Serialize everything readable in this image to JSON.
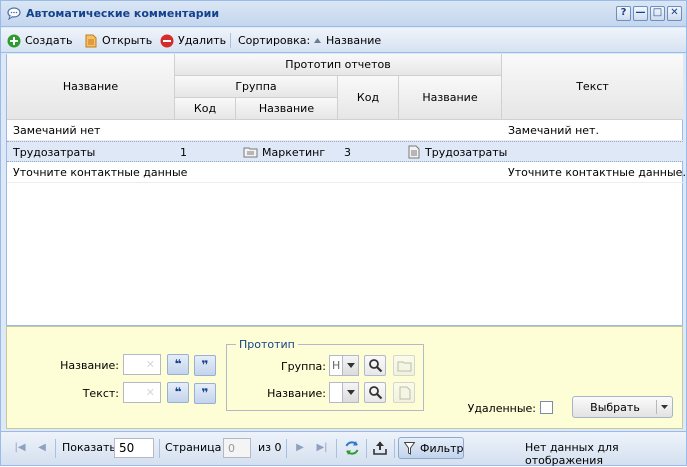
{
  "window": {
    "title": "Автоматические комментарии",
    "buttons": [
      "?",
      "—",
      "□",
      "✕"
    ]
  },
  "toolbar": {
    "create_label": "Создать",
    "open_label": "Открыть",
    "delete_label": "Удалить",
    "sort_label": "Сортировка:",
    "sort_field": "Название"
  },
  "grid": {
    "headers": {
      "name": "Название",
      "prototype": "Прототип отчетов",
      "group": "Группа",
      "group_code": "Код",
      "group_name": "Название",
      "proto_code": "Код",
      "proto_name": "Название",
      "text": "Текст"
    },
    "rows": [
      {
        "name": "Замечаний нет",
        "group_code": "",
        "group_name": "",
        "proto_code": "",
        "proto_name": "",
        "text": "Замечаний нет."
      },
      {
        "name": "Трудозатраты",
        "group_code": "1",
        "group_name": "Маркетинг",
        "proto_code": "3",
        "proto_name": "Трудозатраты",
        "text": ""
      },
      {
        "name": "Уточните контактные данные",
        "group_code": "",
        "group_name": "",
        "proto_code": "",
        "proto_name": "",
        "text": "Уточните контактные данные."
      }
    ]
  },
  "filter": {
    "name_label": "Название:",
    "text_label": "Текст:",
    "prototype_legend": "Прототип",
    "group_label": "Группа:",
    "group_value": "Н",
    "proto_name_label": "Название:",
    "deleted_label": "Удаленные:",
    "select_label": "Выбрать"
  },
  "pager": {
    "show_label": "Показать",
    "page_size": "50",
    "page_label": "Страница",
    "page_value": "0",
    "of_label": "из 0",
    "filter_label": "Фильтр",
    "status": "Нет данных для отображения"
  },
  "colors": {
    "accent": "#15428b",
    "border": "#99bbe8",
    "filter_bg": "#fefed6",
    "selected_row": "#dfe8f6"
  }
}
